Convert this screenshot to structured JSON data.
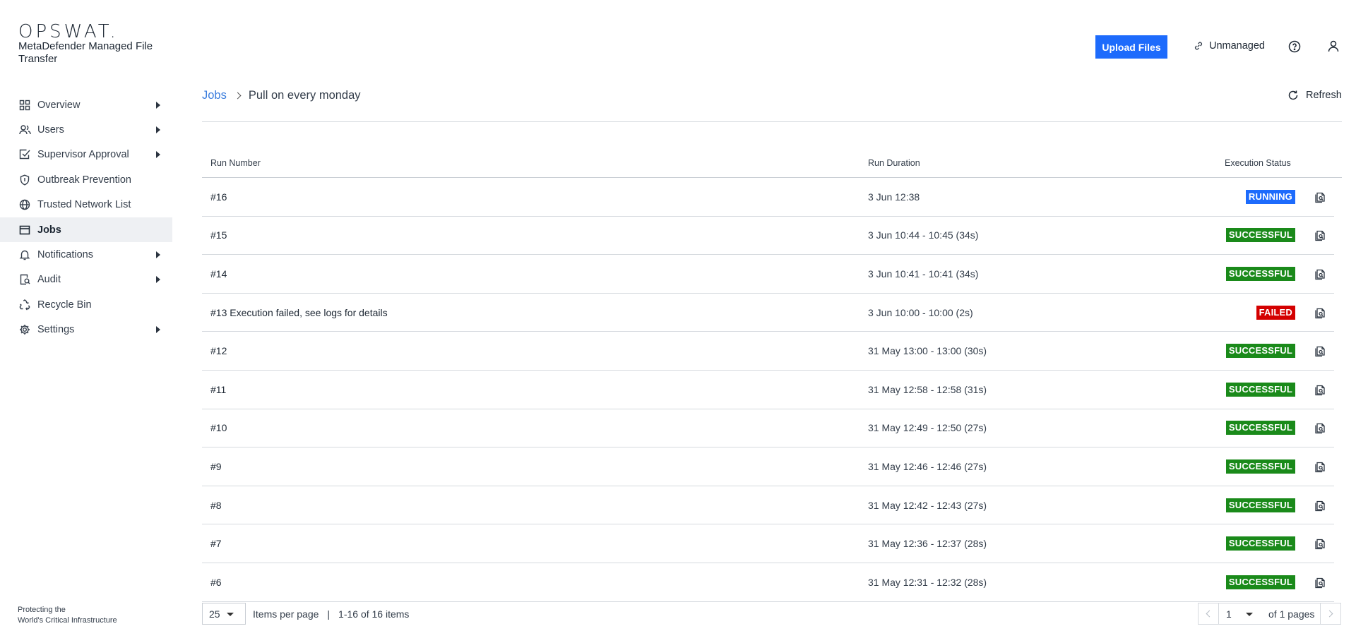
{
  "brand": {
    "logo": "OPSWAT.",
    "product": "MetaDefender Managed File Transfer",
    "tagline_line1": "Protecting the",
    "tagline_line2": "World's Critical Infrastructure"
  },
  "sidebar": {
    "items": [
      {
        "label": "Overview",
        "icon": "grid-icon",
        "arrow": true
      },
      {
        "label": "Users",
        "icon": "users-icon",
        "arrow": true
      },
      {
        "label": "Supervisor Approval",
        "icon": "checkbox-icon",
        "arrow": true
      },
      {
        "label": "Outbreak Prevention",
        "icon": "shield-icon",
        "arrow": false
      },
      {
        "label": "Trusted Network List",
        "icon": "globe-icon",
        "arrow": false
      },
      {
        "label": "Jobs",
        "icon": "window-icon",
        "arrow": false,
        "active": true
      },
      {
        "label": "Notifications",
        "icon": "bell-icon",
        "arrow": true
      },
      {
        "label": "Audit",
        "icon": "audit-icon",
        "arrow": true
      },
      {
        "label": "Recycle Bin",
        "icon": "recycle-icon",
        "arrow": false
      },
      {
        "label": "Settings",
        "icon": "gear-icon",
        "arrow": true
      }
    ]
  },
  "header": {
    "upload_label": "Upload Files",
    "unmanaged_label": "Unmanaged"
  },
  "breadcrumb": {
    "root": "Jobs",
    "current": "Pull on every monday"
  },
  "refresh_label": "Refresh",
  "table": {
    "columns": {
      "run_number": "Run Number",
      "run_duration": "Run Duration",
      "status": "Execution Status"
    },
    "rows": [
      {
        "run": "#16",
        "duration": "3 Jun 12:38",
        "status": "RUNNING"
      },
      {
        "run": "#15",
        "duration": "3 Jun 10:44 - 10:45 (34s)",
        "status": "SUCCESSFUL"
      },
      {
        "run": "#14",
        "duration": "3 Jun 10:41 - 10:41 (34s)",
        "status": "SUCCESSFUL"
      },
      {
        "run": "#13 Execution failed, see logs for details",
        "duration": "3 Jun 10:00 - 10:00 (2s)",
        "status": "FAILED"
      },
      {
        "run": "#12",
        "duration": "31 May 13:00 - 13:00 (30s)",
        "status": "SUCCESSFUL"
      },
      {
        "run": "#11",
        "duration": "31 May 12:58 - 12:58 (31s)",
        "status": "SUCCESSFUL"
      },
      {
        "run": "#10",
        "duration": "31 May 12:49 - 12:50 (27s)",
        "status": "SUCCESSFUL"
      },
      {
        "run": "#9",
        "duration": "31 May 12:46 - 12:46 (27s)",
        "status": "SUCCESSFUL"
      },
      {
        "run": "#8",
        "duration": "31 May 12:42 - 12:43 (27s)",
        "status": "SUCCESSFUL"
      },
      {
        "run": "#7",
        "duration": "31 May 12:36 - 12:37 (28s)",
        "status": "SUCCESSFUL"
      },
      {
        "run": "#6",
        "duration": "31 May 12:31 - 12:32 (28s)",
        "status": "SUCCESSFUL"
      }
    ]
  },
  "status_colors": {
    "RUNNING": "#1d6bfc",
    "SUCCESSFUL": "#1a8a1a",
    "FAILED": "#d40000"
  },
  "pagination": {
    "per_page": "25",
    "per_page_label": "Items per page",
    "separator": "|",
    "range": "1-16 of 16 items",
    "page": "1",
    "of_pages": "of 1 pages"
  }
}
